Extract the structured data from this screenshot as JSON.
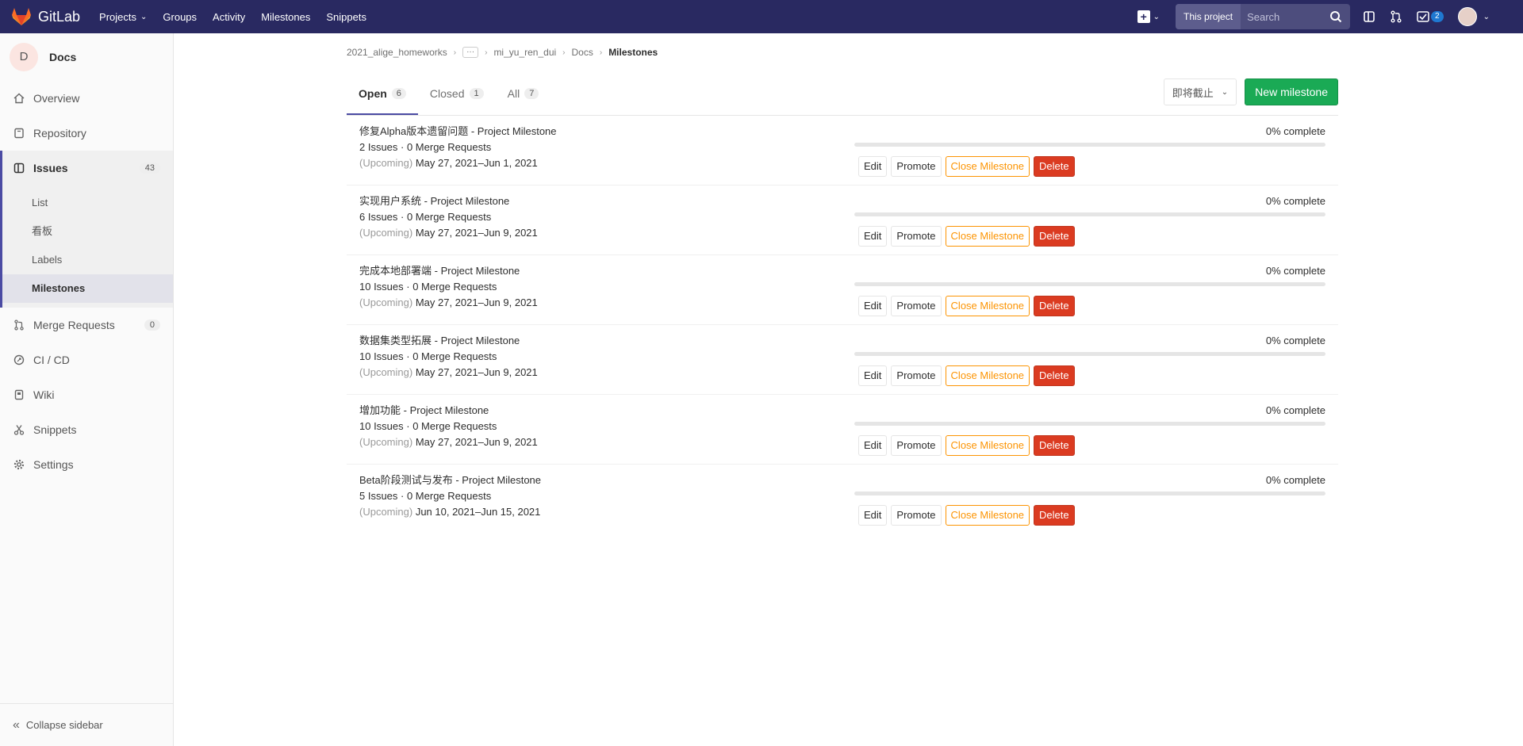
{
  "navbar": {
    "brand": "GitLab",
    "links": [
      {
        "label": "Projects",
        "dropdown": true
      },
      {
        "label": "Groups"
      },
      {
        "label": "Activity"
      },
      {
        "label": "Milestones"
      },
      {
        "label": "Snippets"
      }
    ],
    "search_scope": "This project",
    "search_placeholder": "Search",
    "todo_count": "2"
  },
  "sidebar": {
    "project_initial": "D",
    "project_name": "Docs",
    "items": [
      {
        "label": "Overview",
        "icon": "home-icon"
      },
      {
        "label": "Repository",
        "icon": "book-icon"
      },
      {
        "label": "Issues",
        "icon": "issues-icon",
        "count": "43"
      },
      {
        "label": "Merge Requests",
        "icon": "merge-request-icon",
        "count": "0"
      },
      {
        "label": "CI / CD",
        "icon": "rocket-icon"
      },
      {
        "label": "Wiki",
        "icon": "wiki-icon"
      },
      {
        "label": "Snippets",
        "icon": "snippet-icon"
      },
      {
        "label": "Settings",
        "icon": "gear-icon"
      }
    ],
    "issues_sub": [
      "List",
      "看板",
      "Labels",
      "Milestones"
    ],
    "collapse_label": "Collapse sidebar"
  },
  "breadcrumb": {
    "group": "2021_alige_homeworks",
    "ellipsis": "···",
    "subgroup": "mi_yu_ren_dui",
    "project": "Docs",
    "current": "Milestones"
  },
  "tabs": [
    {
      "label": "Open",
      "count": "6"
    },
    {
      "label": "Closed",
      "count": "1"
    },
    {
      "label": "All",
      "count": "7"
    }
  ],
  "sort_label": "即将截止",
  "new_milestone_label": "New milestone",
  "milestone_suffix": " - Project Milestone",
  "upcoming_label": "(Upcoming)",
  "buttons": {
    "edit": "Edit",
    "promote": "Promote",
    "close": "Close Milestone",
    "delete": "Delete"
  },
  "milestones": [
    {
      "title": "修复Alpha版本遗留问题",
      "meta": "2 Issues · 0 Merge Requests",
      "dates": "May 27, 2021–Jun 1, 2021",
      "complete": "0% complete",
      "progress": 0
    },
    {
      "title": "实现用户系统",
      "meta": "6 Issues · 0 Merge Requests",
      "dates": "May 27, 2021–Jun 9, 2021",
      "complete": "0% complete",
      "progress": 0
    },
    {
      "title": "完成本地部署端",
      "meta": "10 Issues · 0 Merge Requests",
      "dates": "May 27, 2021–Jun 9, 2021",
      "complete": "0% complete",
      "progress": 0
    },
    {
      "title": "数据集类型拓展",
      "meta": "10 Issues · 0 Merge Requests",
      "dates": "May 27, 2021–Jun 9, 2021",
      "complete": "0% complete",
      "progress": 0
    },
    {
      "title": "增加功能",
      "meta": "10 Issues · 0 Merge Requests",
      "dates": "May 27, 2021–Jun 9, 2021",
      "complete": "0% complete",
      "progress": 0
    },
    {
      "title": "Beta阶段测试与发布",
      "meta": "5 Issues · 0 Merge Requests",
      "dates": "Jun 10, 2021–Jun 15, 2021",
      "complete": "0% complete",
      "progress": 0
    }
  ]
}
